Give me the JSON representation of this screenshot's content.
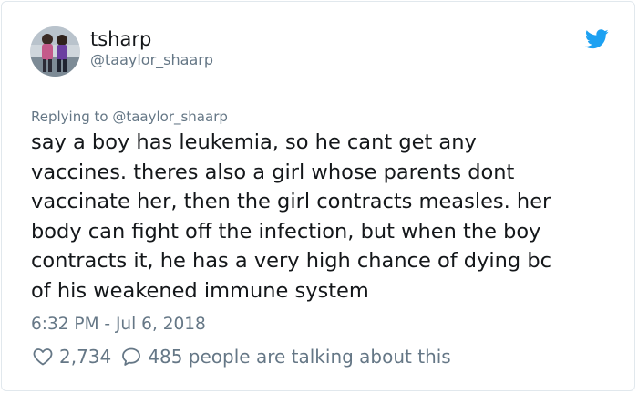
{
  "author": {
    "display_name": "tsharp",
    "handle": "@taaylor_shaarp",
    "avatar_icon": "profile-photo"
  },
  "reply": {
    "text": "Replying to @taaylor_shaarp"
  },
  "tweet": {
    "text": "say a boy has leukemia, so he cant get any\nvaccines. theres also a girl whose parents dont\nvaccinate her, then the girl contracts measles. her\nbody can fight off the infection, but when the boy\ncontracts it, he has a very high chance of dying bc\nof his weakened immune system"
  },
  "meta": {
    "timestamp": "6:32 PM - Jul 6, 2018"
  },
  "actions": {
    "likes": "2,734",
    "talking": "485 people are talking about this",
    "like_icon": "heart-icon",
    "reply_icon": "speech-bubble-icon"
  },
  "brand": {
    "icon": "twitter-bird-icon",
    "color": "#1da1f2"
  },
  "colors": {
    "text": "#14171a",
    "secondary": "#657786",
    "border": "#e1e8ed"
  }
}
